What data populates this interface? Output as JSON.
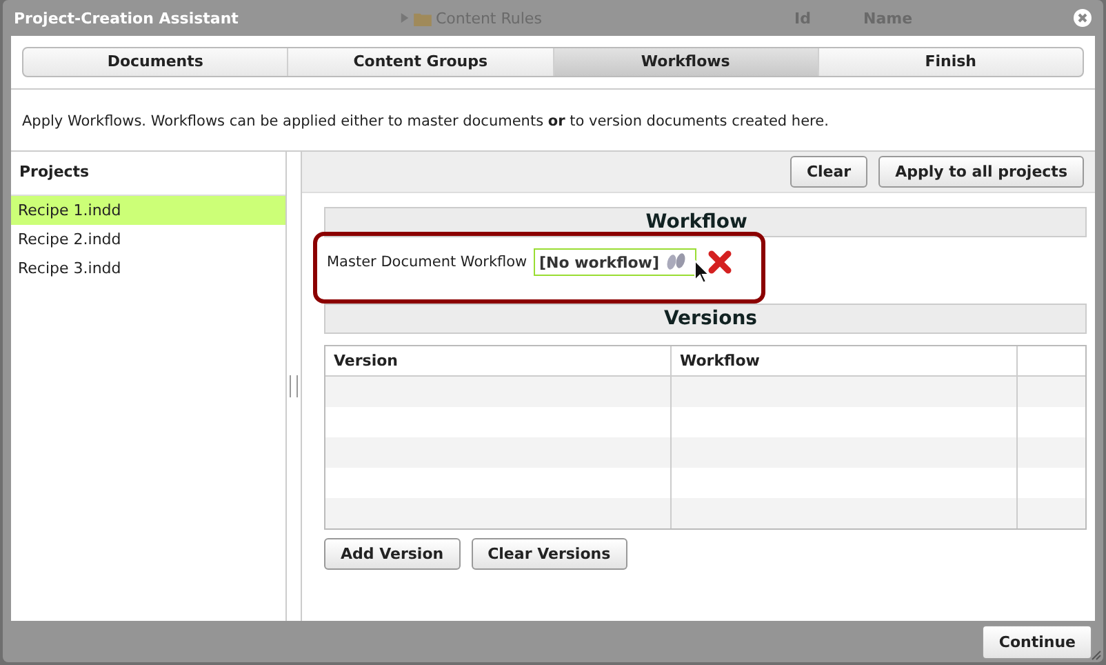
{
  "window": {
    "title": "Project-Creation Assistant"
  },
  "background": {
    "tree_item": "Content Rules",
    "columns": [
      "Id",
      "Name"
    ]
  },
  "steps": [
    {
      "label": "Documents",
      "selected": false
    },
    {
      "label": "Content Groups",
      "selected": false
    },
    {
      "label": "Workflows",
      "selected": true
    },
    {
      "label": "Finish",
      "selected": false
    }
  ],
  "description": "Apply Workflows. Workflows can be applied either to master documents **or** to version documents created here.",
  "projects": {
    "title": "Projects",
    "items": [
      {
        "label": "Recipe 1.indd",
        "selected": true
      },
      {
        "label": "Recipe 2.indd",
        "selected": false
      },
      {
        "label": "Recipe 3.indd",
        "selected": false
      }
    ]
  },
  "toolbar": {
    "buttons": [
      "Clear",
      "Apply to all projects"
    ]
  },
  "workflow": {
    "title": "Workflow",
    "label": "Master Document Workflow",
    "value": "[No workflow]"
  },
  "versions": {
    "title": "Versions",
    "columns": [
      "Version",
      "Workflow"
    ],
    "buttons": [
      "Add Version",
      "Clear Versions"
    ]
  },
  "footer": {
    "button": "Continue"
  }
}
